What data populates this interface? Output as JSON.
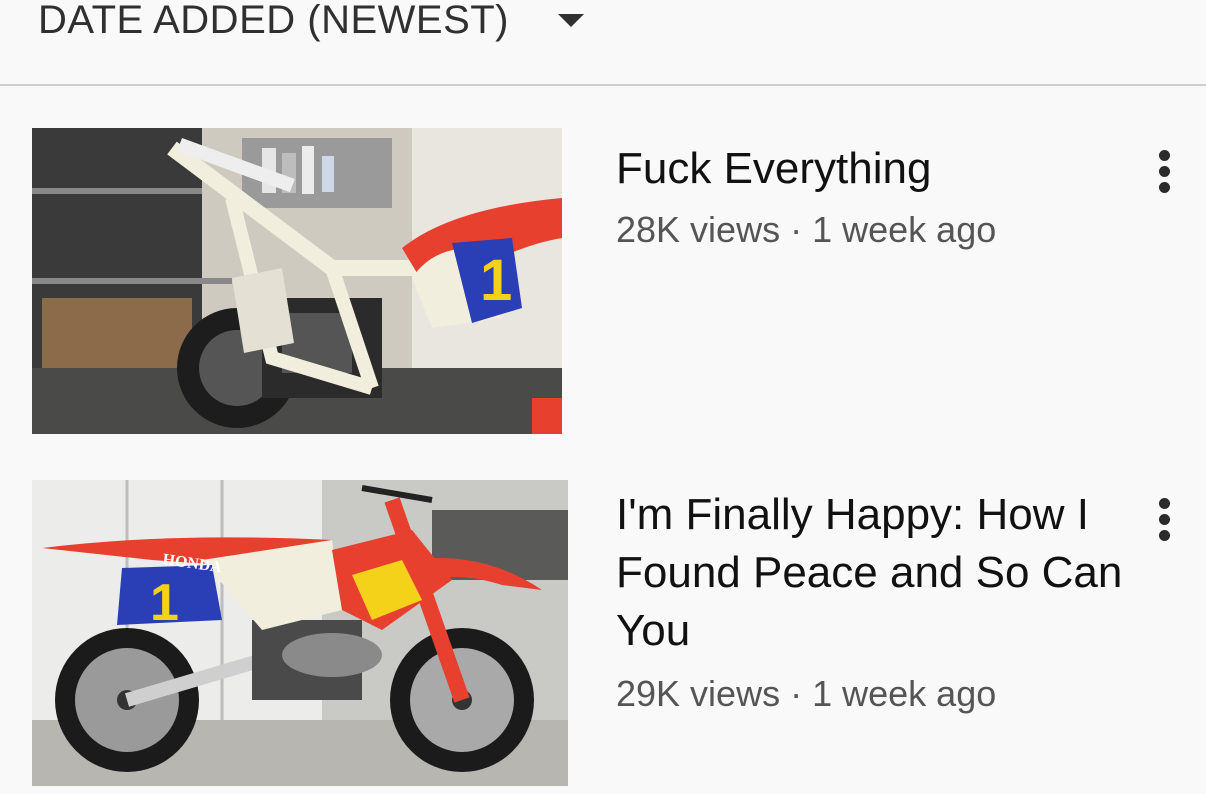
{
  "sort": {
    "label": "DATE ADDED (NEWEST)",
    "icon": "caret-down-icon"
  },
  "videos": [
    {
      "title": "Fuck Everything",
      "views": "28K views",
      "separator": "·",
      "age": "1 week ago",
      "menu_icon": "more-vert-icon"
    },
    {
      "title": "I'm Finally Happy: How I Found Peace and So Can You",
      "views": "29K views",
      "separator": "·",
      "age": "1 week ago",
      "menu_icon": "more-vert-icon",
      "thumb_text": {
        "brand": "HONDA",
        "number": "1"
      }
    }
  ],
  "thumb1_text": {
    "number": "1"
  },
  "colors": {
    "bike_red": "#e8402f",
    "number_plate_blue": "#2a3fb5",
    "number_yellow": "#f4d21a",
    "frame_white": "#f2eedd"
  }
}
